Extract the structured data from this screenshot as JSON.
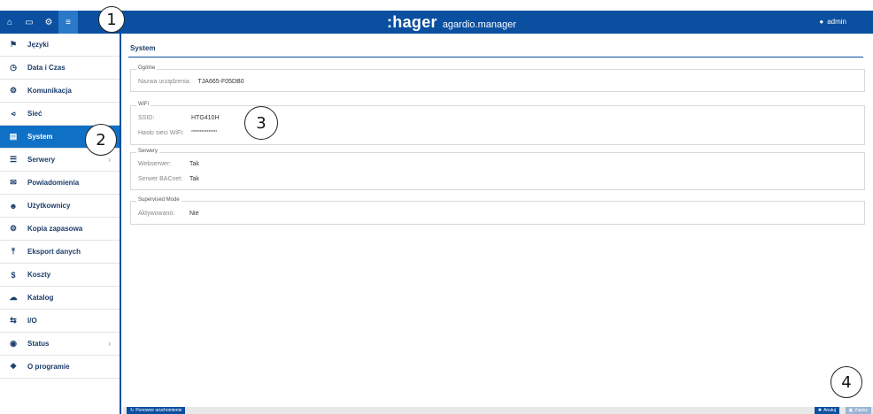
{
  "topbar": {
    "icons": [
      "home-icon",
      "monitor-icon",
      "cogs-icon",
      "sliders-icon"
    ],
    "brand_logo": ":hager",
    "brand_product": "agardio.manager",
    "user_icon": "user-icon",
    "user_name": "admin",
    "color": "#0a4fa0"
  },
  "sidebar": {
    "items": [
      {
        "label": "Języki",
        "icon": "flag-icon"
      },
      {
        "label": "Data i Czas",
        "icon": "clock-icon"
      },
      {
        "label": "Komunikacja",
        "icon": "cogs-icon"
      },
      {
        "label": "Sieć",
        "icon": "share-icon"
      },
      {
        "label": "System",
        "icon": "hdd-icon",
        "active": true
      },
      {
        "label": "Serwery",
        "icon": "server-icon",
        "has_submenu": true
      },
      {
        "label": "Powiadomienia",
        "icon": "envelope-icon"
      },
      {
        "label": "Użytkownicy",
        "icon": "users-icon"
      },
      {
        "label": "Kopia zapasowa",
        "icon": "cogs-icon"
      },
      {
        "label": "Eksport danych",
        "icon": "upload-icon"
      },
      {
        "label": "Koszty",
        "icon": "dollar-icon"
      },
      {
        "label": "Katalog",
        "icon": "cloud-upload-icon"
      },
      {
        "label": "I/O",
        "icon": "exchange-icon"
      },
      {
        "label": "Status",
        "icon": "eye-icon",
        "has_submenu": true
      },
      {
        "label": "O programie",
        "icon": "info-icon"
      }
    ],
    "active_color": "#0f71c6"
  },
  "main": {
    "title": "System",
    "sections": {
      "general": {
        "legend": "Ogólne",
        "device_name_label": "Nazwa urządzenia:",
        "device_name_value": "TJA665-F05DB0"
      },
      "wifi": {
        "legend": "WiFi",
        "ssid_label": "SSID:",
        "ssid_value": "HTG410H",
        "password_label": "Hasło sieci WiFi:",
        "password_value": "***************"
      },
      "servers": {
        "legend": "Serwery",
        "webserver_label": "Webserwer:",
        "webserver_value": "Tak",
        "bacnet_label": "Serwer BACnet:",
        "bacnet_value": "Tak"
      },
      "supervised": {
        "legend": "Supervised Mode",
        "activated_label": "Aktywowano:",
        "activated_value": "Nie"
      }
    }
  },
  "statusbar": {
    "restart_label": "Ponowne uruchomienie",
    "cancel_label": "Anuluj",
    "save_label": "Zapisz"
  },
  "callouts": [
    "1",
    "2",
    "3",
    "4"
  ]
}
